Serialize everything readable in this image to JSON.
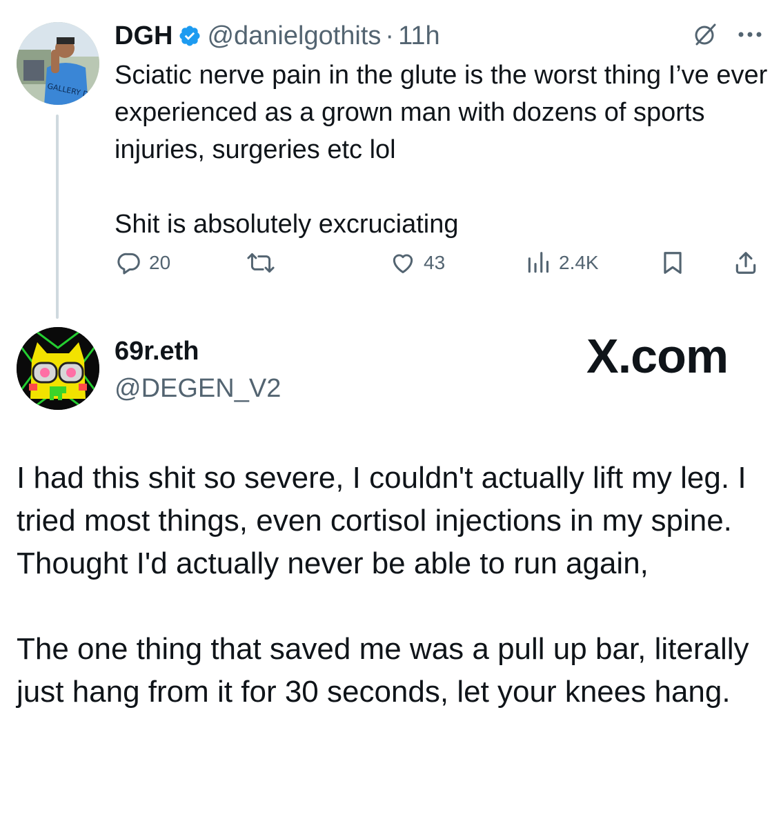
{
  "tweet": {
    "author_name": "DGH",
    "handle": "@danielgothits",
    "separator": "·",
    "time": "11h",
    "paragraphs": [
      "Sciatic nerve pain in the glute is the worst thing I’ve ever experienced as a grown man with dozens of sports injuries, surgeries etc lol",
      "Shit is absolutely excruciating"
    ],
    "avatar_shirt_text": "GALLERY DEPT",
    "stats": {
      "replies": "20",
      "reposts": "",
      "likes": "43",
      "views": "2.4K"
    },
    "icons": [
      "grok-icon",
      "more-options-icon",
      "reply-icon",
      "repost-icon",
      "like-icon",
      "views-icon",
      "bookmark-icon",
      "share-icon"
    ],
    "accent_color": "#1d9bf0"
  },
  "reply": {
    "author_name": "69r.eth",
    "handle": "@DEGEN_V2",
    "paragraphs": [
      "I had this shit so severe, I couldn't actually lift my leg. I tried most things, even cortisol injections in my spine. Thought I'd actually never be able to run again,",
      "The one thing that saved me was a pull up bar, literally just hang from it for 30 seconds, let your knees hang."
    ]
  },
  "brand": {
    "text": "X.com"
  },
  "colors": {
    "text_primary": "#0f1419",
    "text_secondary": "#536471",
    "thread_line": "#cfd9de",
    "background": "#ffffff"
  }
}
